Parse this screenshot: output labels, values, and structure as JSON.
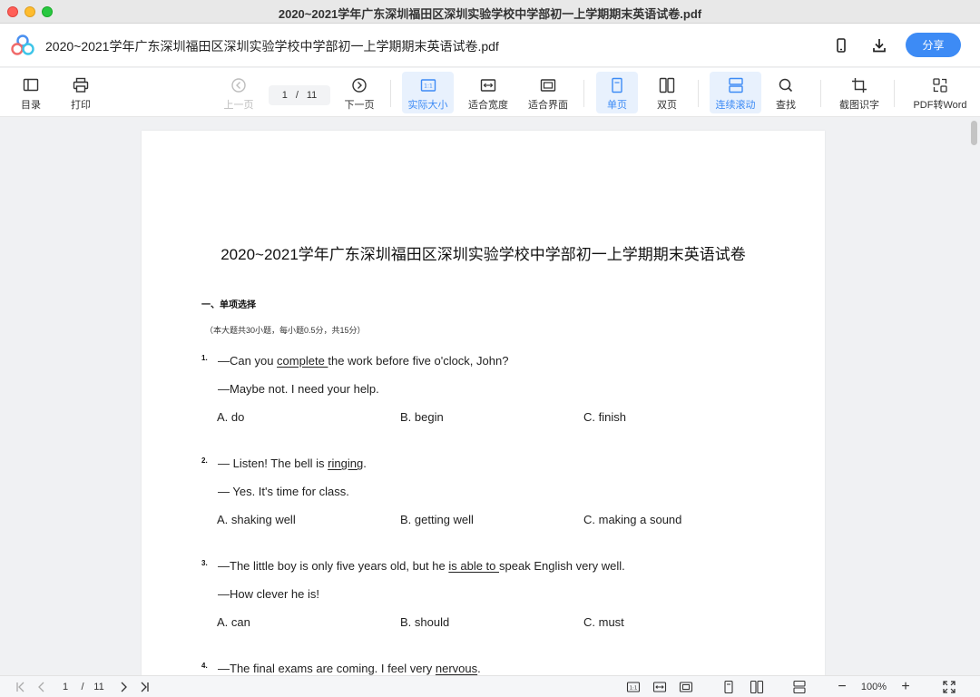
{
  "window": {
    "title": "2020~2021学年广东深圳福田区深圳实验学校中学部初一上学期期末英语试卷.pdf"
  },
  "header": {
    "doc_title": "2020~2021学年广东深圳福田区深圳实验学校中学部初一上学期期末英语试卷.pdf",
    "share_label": "分享",
    "icons": [
      "mobile-icon",
      "download-icon"
    ]
  },
  "toolbar": {
    "toc": "目录",
    "print": "打印",
    "prev": "上一页",
    "page_current": "1",
    "page_sep": "/",
    "page_total": "11",
    "next": "下一页",
    "actual_size": "实际大小",
    "fit_width": "适合宽度",
    "fit_page": "适合界面",
    "single_page": "单页",
    "double_page": "双页",
    "continuous": "连续滚动",
    "search": "查找",
    "ocr": "截图识字",
    "pdf_to_word": "PDF转Word",
    "accent": "#3d8bf5"
  },
  "document": {
    "title": "2020~2021学年广东深圳福田区深圳实验学校中学部初一上学期期末英语试卷",
    "section_title": "一、单项选择",
    "section_note": "（本大题共30小题，每小题0.5分，共15分）",
    "questions": [
      {
        "num": "1.",
        "line1": {
          "pre": "—Can you ",
          "u": "complete ",
          "post": "the work before five o'clock, John?"
        },
        "line2": "—Maybe not. I need your help.",
        "options": [
          "A. do",
          "B. begin",
          "C. finish"
        ]
      },
      {
        "num": "2.",
        "line1": {
          "pre": "— Listen! The bell is ",
          "u": "ringing",
          "post": "."
        },
        "line2": "— Yes. It's time for class.",
        "options": [
          "A. shaking well",
          "B. getting well",
          "C. making a sound"
        ]
      },
      {
        "num": "3.",
        "line1": {
          "pre": "—The little boy is only five years old, but he ",
          "u": "is able to ",
          "post": "speak English very well."
        },
        "line2": "—How clever he is!",
        "options": [
          "A. can",
          "B. should",
          "C. must"
        ]
      },
      {
        "num": "4.",
        "line1": {
          "pre": "—The final exams are coming. I feel very ",
          "u": "nervous",
          "post": "."
        }
      }
    ]
  },
  "statusbar": {
    "page_current": "1",
    "page_sep": "/",
    "page_total": "11",
    "zoom": "100%",
    "zoom_out": "−",
    "zoom_in": "+"
  }
}
